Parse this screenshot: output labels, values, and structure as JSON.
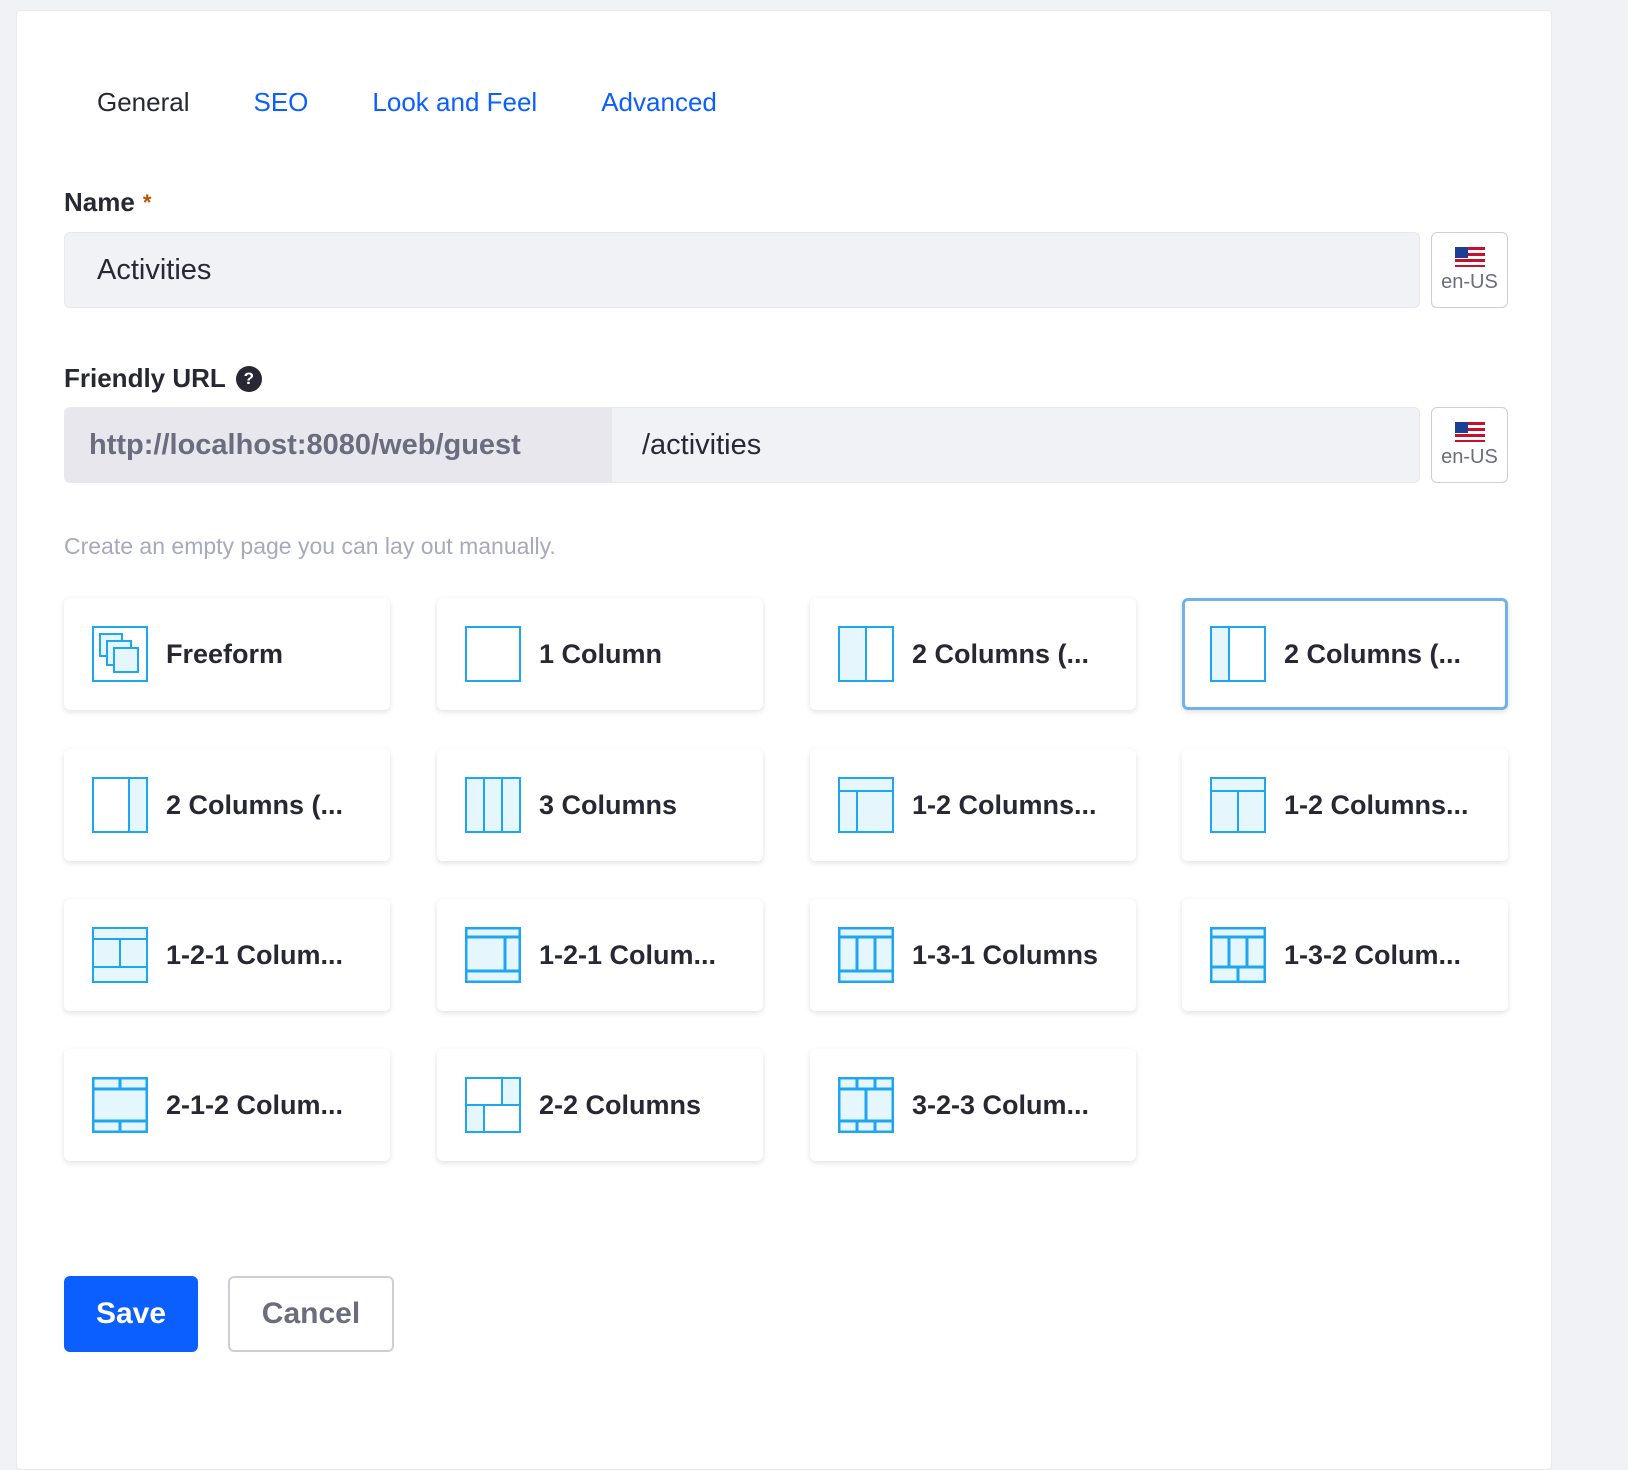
{
  "tabs": [
    {
      "label": "General",
      "active": true
    },
    {
      "label": "SEO"
    },
    {
      "label": "Look and Feel"
    },
    {
      "label": "Advanced"
    }
  ],
  "name_field": {
    "label": "Name",
    "required_mark": "*",
    "value": "Activities",
    "locale": "en-US"
  },
  "url_field": {
    "label": "Friendly URL",
    "help_glyph": "?",
    "prefix": "http://localhost:8080/web/guest",
    "value": "/activities",
    "locale": "en-US"
  },
  "hint": "Create an empty page you can lay out manually.",
  "layouts": [
    {
      "label": "Freeform",
      "icon": "freeform-layout-icon"
    },
    {
      "label": "1 Column",
      "icon": "one-column-layout-icon"
    },
    {
      "label": "2 Columns (...",
      "icon": "two-columns-wide-right-icon"
    },
    {
      "label": "2 Columns (...",
      "icon": "two-columns-narrow-left-icon",
      "selected": true
    },
    {
      "label": "2 Columns (...",
      "icon": "two-columns-narrow-right-icon"
    },
    {
      "label": "3 Columns",
      "icon": "three-columns-layout-icon"
    },
    {
      "label": "1-2 Columns...",
      "icon": "one-two-columns-icon"
    },
    {
      "label": "1-2 Columns...",
      "icon": "one-two-columns-alt-icon"
    },
    {
      "label": "1-2-1 Colum...",
      "icon": "one-two-one-columns-icon"
    },
    {
      "label": "1-2-1 Colum...",
      "icon": "one-two-one-columns-alt-icon"
    },
    {
      "label": "1-3-1 Columns",
      "icon": "one-three-one-columns-icon"
    },
    {
      "label": "1-3-2 Colum...",
      "icon": "one-three-two-columns-icon"
    },
    {
      "label": "2-1-2 Colum...",
      "icon": "two-one-two-columns-icon"
    },
    {
      "label": "2-2 Columns",
      "icon": "two-two-columns-icon"
    },
    {
      "label": "3-2-3 Colum...",
      "icon": "three-two-three-columns-icon"
    }
  ],
  "buttons": {
    "save": "Save",
    "cancel": "Cancel"
  },
  "colors": {
    "primary": "#0b5fff",
    "icon_stroke": "#1ea7f0",
    "icon_fill": "#e6f6fd",
    "selected_border": "#6fb3e8"
  }
}
